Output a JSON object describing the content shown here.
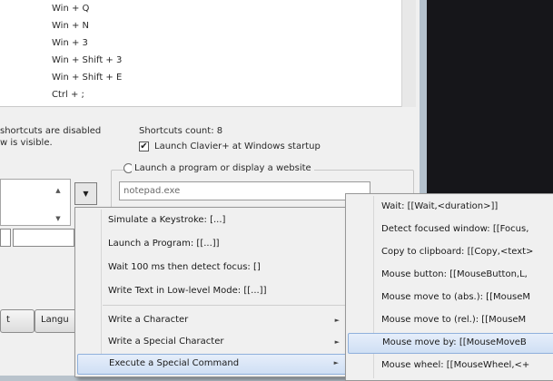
{
  "shortcuts_list": [
    "Win + Q",
    "Win + N",
    "Win + 3",
    "Win + Shift + 3",
    "Win + Shift + E",
    "Ctrl + ;"
  ],
  "status": {
    "disabled_line1": "shortcuts are disabled",
    "disabled_line2": "w is visible.",
    "count_label": "Shortcuts count:  8",
    "startup_checkbox_label": "Launch Clavier+ at Windows startup",
    "startup_checked": true,
    "checkmark": "✔"
  },
  "action": {
    "launch_radio_label": "Launch a program or display a website",
    "path_value": "notepad.exe",
    "spin_up_icon": "▲",
    "spin_down_icon": "▼",
    "dropdown_icon": "▼"
  },
  "buttons": {
    "partial_1": "t",
    "language_partial": "Langu"
  },
  "context_menu": {
    "items": [
      "Simulate a Keystroke: [...]",
      "Launch a Program: [[...]]",
      "Wait 100 ms then detect focus: []",
      "Write Text in Low-level Mode: [[...]]",
      "Write a Character",
      "Write a Special Character",
      "Execute a Special Command"
    ],
    "arrow_icon": "►"
  },
  "submenu": {
    "items": [
      "Wait: [[Wait,<duration>]]",
      "Detect focused window: [[Focus,",
      "Copy to clipboard: [[Copy,<text>",
      "Mouse button: [[MouseButton,L,",
      "Mouse move to (abs.): [[MouseM",
      "Mouse move to (rel.): [[MouseM",
      "Mouse move by: [[MouseMoveB",
      "Mouse wheel: [[MouseWheel,<+"
    ]
  },
  "colors": {
    "highlight": "#cfdff4",
    "menu_bg": "#f0f0f0",
    "dark_bg": "#16161a"
  }
}
